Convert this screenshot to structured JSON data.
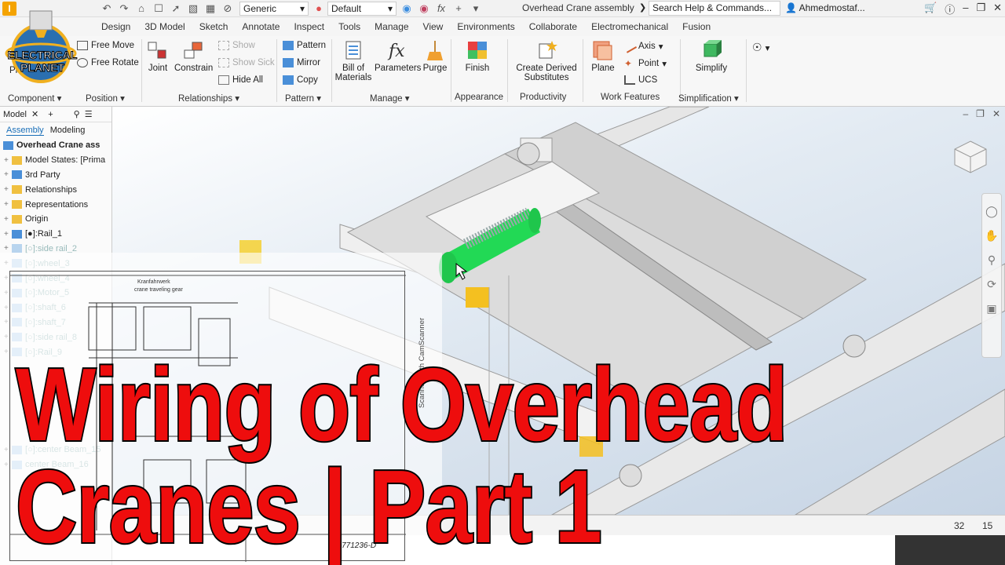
{
  "window": {
    "title": "Overhead Crane assembly",
    "search_placeholder": "Search Help & Commands...",
    "user": "Ahmedmostaf...",
    "material_combo": "Generic",
    "appearance_combo": "Default"
  },
  "tabs": [
    "Design",
    "3D Model",
    "Sketch",
    "Annotate",
    "Inspect",
    "Tools",
    "Manage",
    "View",
    "Environments",
    "Collaborate",
    "Electromechanical",
    "Fusion"
  ],
  "ribbon": {
    "component": {
      "place": "Pla",
      "free_move": "Free Move",
      "free_rotate": "Free Rotate",
      "label": "Component",
      "position_label": "Position"
    },
    "relationships": {
      "joint": "Joint",
      "constrain": "Constrain",
      "show": "Show",
      "show_sick": "Show Sick",
      "hide_all": "Hide All",
      "label": "Relationships"
    },
    "pattern": {
      "pattern": "Pattern",
      "mirror": "Mirror",
      "copy": "Copy",
      "label": "Pattern"
    },
    "manage": {
      "bom_line1": "Bill of",
      "bom_line2": "Materials",
      "parameters": "Parameters",
      "purge": "Purge",
      "label": "Manage"
    },
    "appearance": {
      "finish": "Finish",
      "label": "Appearance"
    },
    "productivity": {
      "create_line1": "Create Derived",
      "create_line2": "Substitutes",
      "label": "Productivity"
    },
    "work_features": {
      "plane": "Plane",
      "axis": "Axis",
      "point": "Point",
      "ucs": "UCS",
      "label": "Work Features"
    },
    "simplification": {
      "simplify": "Simplify",
      "label": "Simplification"
    }
  },
  "browser": {
    "header": "Model",
    "tab_assembly": "Assembly",
    "tab_modeling": "Modeling",
    "root": "Overhead Crane ass",
    "items": [
      {
        "label": "Model States: [Prima",
        "faded": false,
        "icon": "folder"
      },
      {
        "label": "3rd Party",
        "faded": false,
        "icon": "part"
      },
      {
        "label": "Relationships",
        "faded": false,
        "icon": "folder"
      },
      {
        "label": "Representations",
        "faded": false,
        "icon": "folder"
      },
      {
        "label": "Origin",
        "faded": false,
        "icon": "folder"
      },
      {
        "label": "[●]:Rail_1",
        "faded": false,
        "icon": "part"
      },
      {
        "label": "[○]:side rail_2",
        "faded": true,
        "icon": "part"
      },
      {
        "label": "[○]:wheel_3",
        "faded": true,
        "icon": "part"
      },
      {
        "label": "[○]:wheel_4",
        "faded": true,
        "icon": "part"
      },
      {
        "label": "[○]:Motor_5",
        "faded": true,
        "icon": "part"
      },
      {
        "label": "[○]:shaft_6",
        "faded": true,
        "icon": "part"
      },
      {
        "label": "[○]:shaft_7",
        "faded": true,
        "icon": "part"
      },
      {
        "label": "[○]:side rail_8",
        "faded": true,
        "icon": "part"
      },
      {
        "label": "[○]:Rail_9",
        "faded": true,
        "icon": "part"
      }
    ],
    "bottom_items": [
      "[○]:center Beam_15",
      "center Beam_16"
    ]
  },
  "drawing": {
    "title_de": "Kranfahrwerk",
    "title_en": "crane traveling gear",
    "scanner": "Scanned with CamScanner",
    "doc_number": "22771236-D"
  },
  "status": {
    "count1": "32",
    "count2": "15"
  },
  "headline": {
    "line1": "Wiring of Overhead",
    "line2": "Cranes | Part 1"
  },
  "logo": {
    "line1": "ELECTRICAL",
    "line2": "PLANET"
  },
  "colors": {
    "headline": "#ee0d0d",
    "highlight": "#22d955",
    "accent": "#1a6fb8"
  }
}
